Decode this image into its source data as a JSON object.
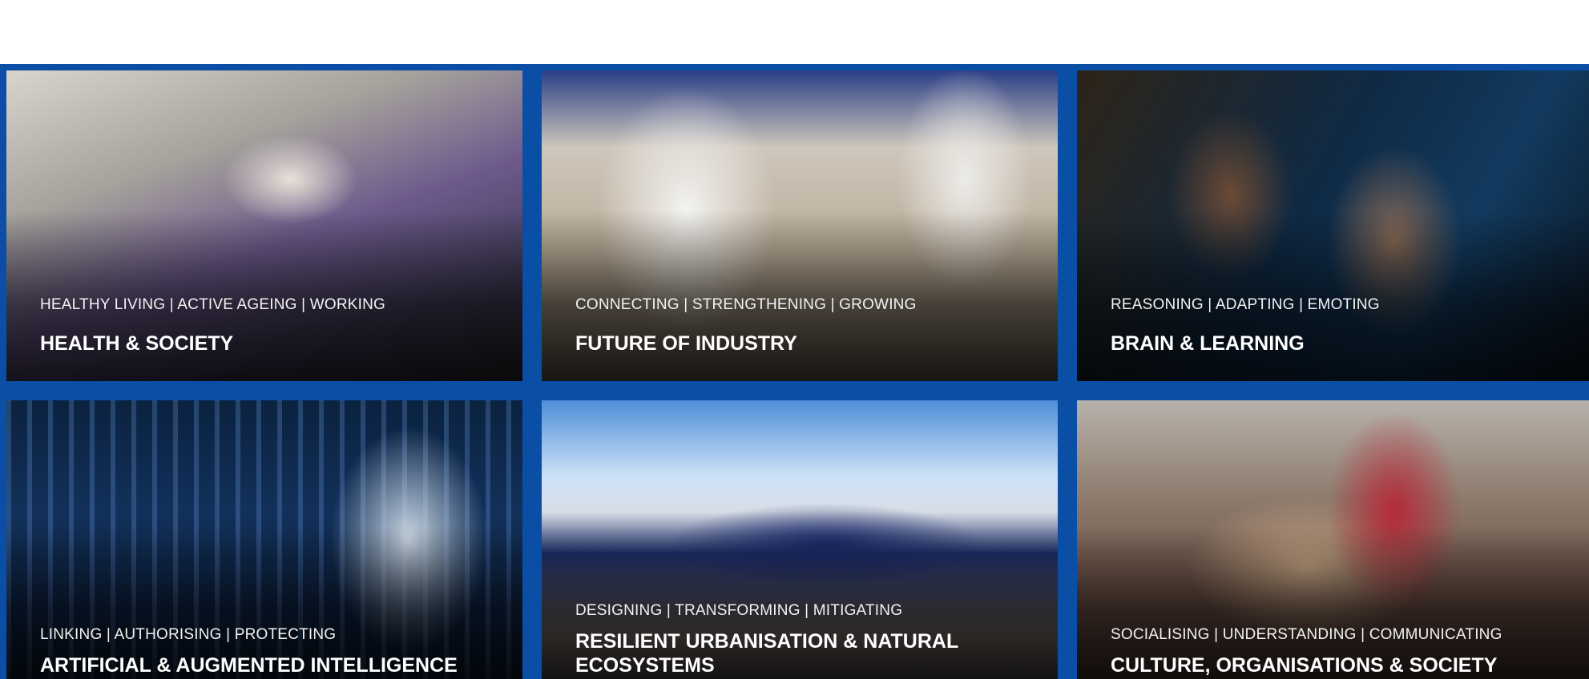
{
  "tiles": [
    {
      "tags": "HEALTHY LIVING | ACTIVE AGEING | WORKING",
      "title": "HEALTH & SOCIETY"
    },
    {
      "tags": "CONNECTING | STRENGTHENING | GROWING",
      "title": "FUTURE OF INDUSTRY"
    },
    {
      "tags": "REASONING | ADAPTING | EMOTING",
      "title": "BRAIN & LEARNING"
    },
    {
      "tags": "LINKING | AUTHORISING | PROTECTING",
      "title": "ARTIFICIAL & AUGMENTED INTELLIGENCE"
    },
    {
      "tags": "DESIGNING | TRANSFORMING | MITIGATING",
      "title": "RESILIENT URBANISATION & NATURAL ECOSYSTEMS"
    },
    {
      "tags": "SOCIALISING | UNDERSTANDING | COMMUNICATING",
      "title": "CULTURE, ORGANISATIONS & SOCIETY"
    }
  ],
  "colors": {
    "frame": "#0a4ea6",
    "text": "#ffffff"
  }
}
